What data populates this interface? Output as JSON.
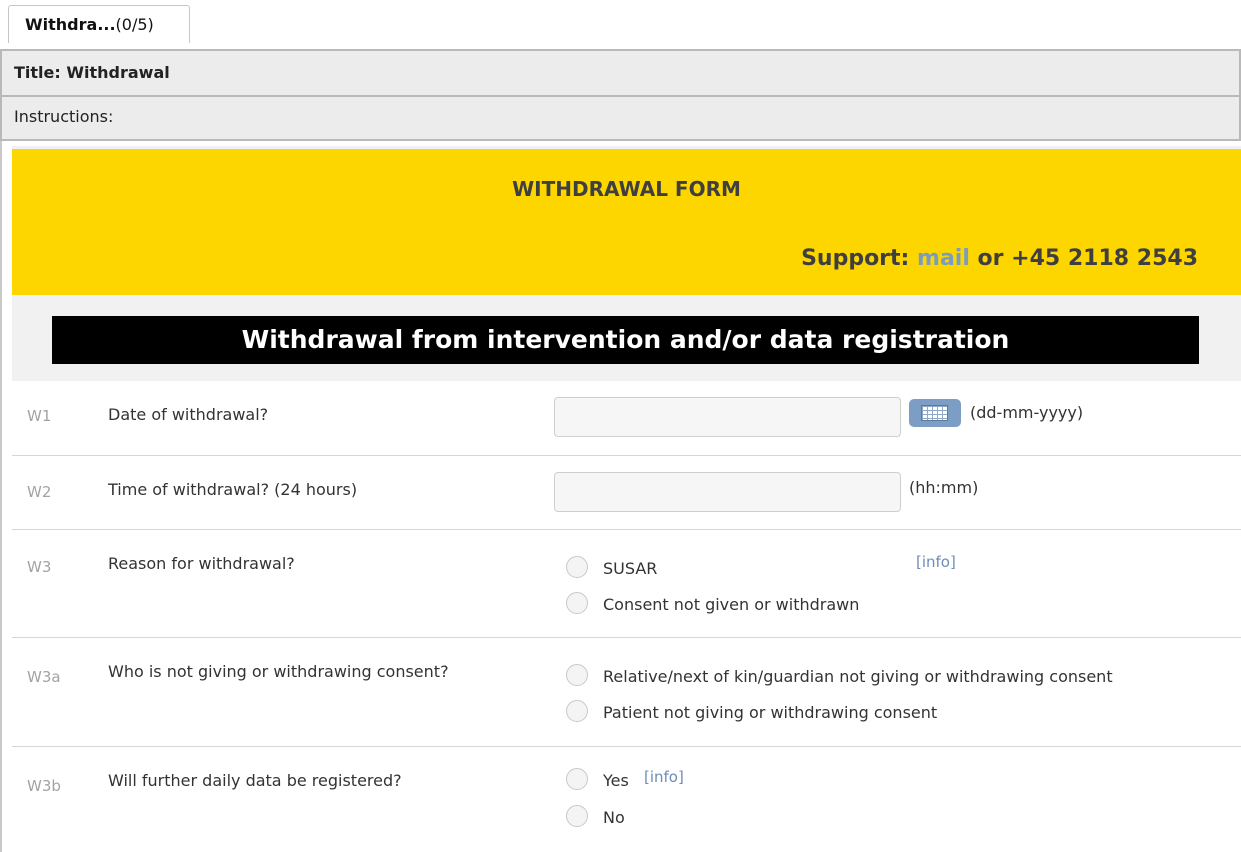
{
  "tab": {
    "name": "Withdra...",
    "count": "(0/5)"
  },
  "title_bar": {
    "text": "Title: Withdrawal"
  },
  "instructions_bar": {
    "text": "Instructions:"
  },
  "banner": {
    "title": "WITHDRAWAL FORM",
    "support_prefix": "Support:",
    "support_link": "mail",
    "support_suffix": "or +45 2118 2543"
  },
  "section_header": "Withdrawal from intervention and/or data registration",
  "questions": [
    {
      "id": "W1",
      "text": "Date of withdrawal?",
      "value": "",
      "format": "(dd-mm-yyyy)"
    },
    {
      "id": "W2",
      "text": "Time of withdrawal? (24 hours)",
      "value": "",
      "format": "(hh:mm)"
    },
    {
      "id": "W3",
      "text": "Reason for withdrawal?",
      "options": [
        "SUSAR",
        "Consent not given or withdrawn"
      ],
      "info": "[info]"
    },
    {
      "id": "W3a",
      "text": "Who is not giving or withdrawing consent?",
      "options": [
        "Relative/next of kin/guardian not giving or withdrawing consent",
        "Patient not giving or withdrawing consent"
      ]
    },
    {
      "id": "W3b",
      "text": "Will further daily data be registered?",
      "options": [
        "Yes",
        "No"
      ],
      "info": "[info]"
    }
  ],
  "colors": {
    "banner": "#fdd600",
    "link": "#7a9cc0",
    "calendar_button": "#7d9ec4"
  },
  "icons": {
    "calendar": "calendar-icon",
    "radio": "radio-button"
  }
}
